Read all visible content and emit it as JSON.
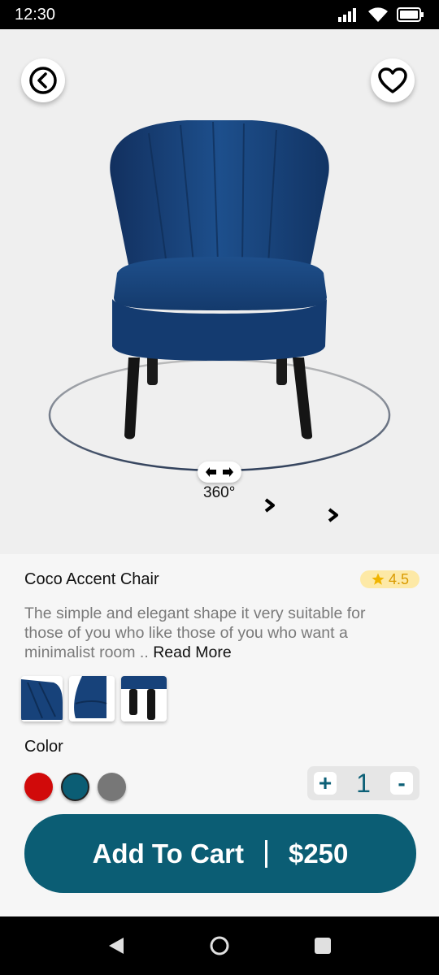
{
  "status_bar": {
    "time": "12:30"
  },
  "hero": {
    "rotate_label": "360°"
  },
  "product": {
    "title": "Coco Accent Chair",
    "rating": "4.5",
    "description": "The simple and elegant shape it very suitable for those of you who like those of you who want a minimalist room ..",
    "read_more": "Read More"
  },
  "color": {
    "label": "Color",
    "swatches": [
      {
        "name": "red",
        "hex": "#d10a0a"
      },
      {
        "name": "teal",
        "hex": "#0b5d74",
        "selected": true
      },
      {
        "name": "gray",
        "hex": "#777777"
      }
    ]
  },
  "quantity": {
    "plus": "+",
    "value": "1",
    "minus": "-"
  },
  "cart": {
    "label": "Add To Cart",
    "price": "$250"
  },
  "colors": {
    "accent": "#0b5d74",
    "rating_bg": "#fde9a6",
    "rating_fg": "#d99a00"
  }
}
